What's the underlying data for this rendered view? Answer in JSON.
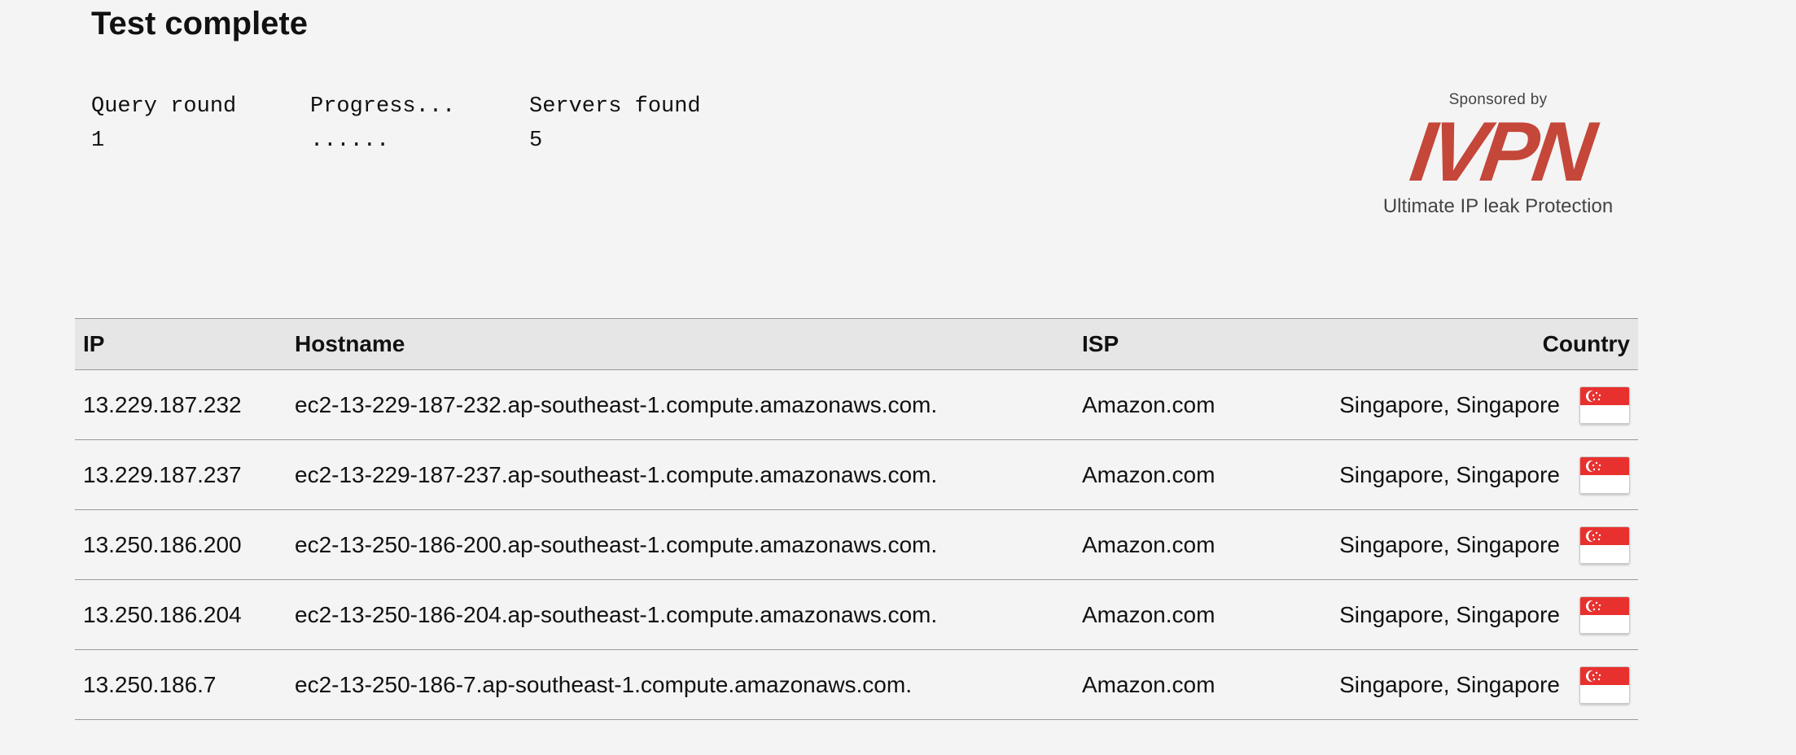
{
  "page": {
    "title": "Test complete"
  },
  "stats": {
    "query_round": {
      "label": "Query round",
      "value": "1"
    },
    "progress": {
      "label": "Progress...",
      "value": "......"
    },
    "servers_found": {
      "label": "Servers found",
      "value": "5"
    }
  },
  "sponsor": {
    "sponsored_by": "Sponsored by",
    "logo_text": "IVPN",
    "tagline": "Ultimate IP leak Protection",
    "brand_color": "#c4473a"
  },
  "table": {
    "headers": {
      "ip": "IP",
      "hostname": "Hostname",
      "isp": "ISP",
      "country": "Country"
    },
    "rows": [
      {
        "ip": "13.229.187.232",
        "hostname": "ec2-13-229-187-232.ap-southeast-1.compute.amazonaws.com.",
        "isp": "Amazon.com",
        "country": "Singapore, Singapore",
        "flag": "singapore-flag-icon"
      },
      {
        "ip": "13.229.187.237",
        "hostname": "ec2-13-229-187-237.ap-southeast-1.compute.amazonaws.com.",
        "isp": "Amazon.com",
        "country": "Singapore, Singapore",
        "flag": "singapore-flag-icon"
      },
      {
        "ip": "13.250.186.200",
        "hostname": "ec2-13-250-186-200.ap-southeast-1.compute.amazonaws.com.",
        "isp": "Amazon.com",
        "country": "Singapore, Singapore",
        "flag": "singapore-flag-icon"
      },
      {
        "ip": "13.250.186.204",
        "hostname": "ec2-13-250-186-204.ap-southeast-1.compute.amazonaws.com.",
        "isp": "Amazon.com",
        "country": "Singapore, Singapore",
        "flag": "singapore-flag-icon"
      },
      {
        "ip": "13.250.186.7",
        "hostname": "ec2-13-250-186-7.ap-southeast-1.compute.amazonaws.com.",
        "isp": "Amazon.com",
        "country": "Singapore, Singapore",
        "flag": "singapore-flag-icon"
      }
    ]
  },
  "colors": {
    "background": "#f4f4f4",
    "header_row": "#e6e6e6",
    "flag_red": "#e8312f",
    "flag_white": "#ffffff"
  }
}
